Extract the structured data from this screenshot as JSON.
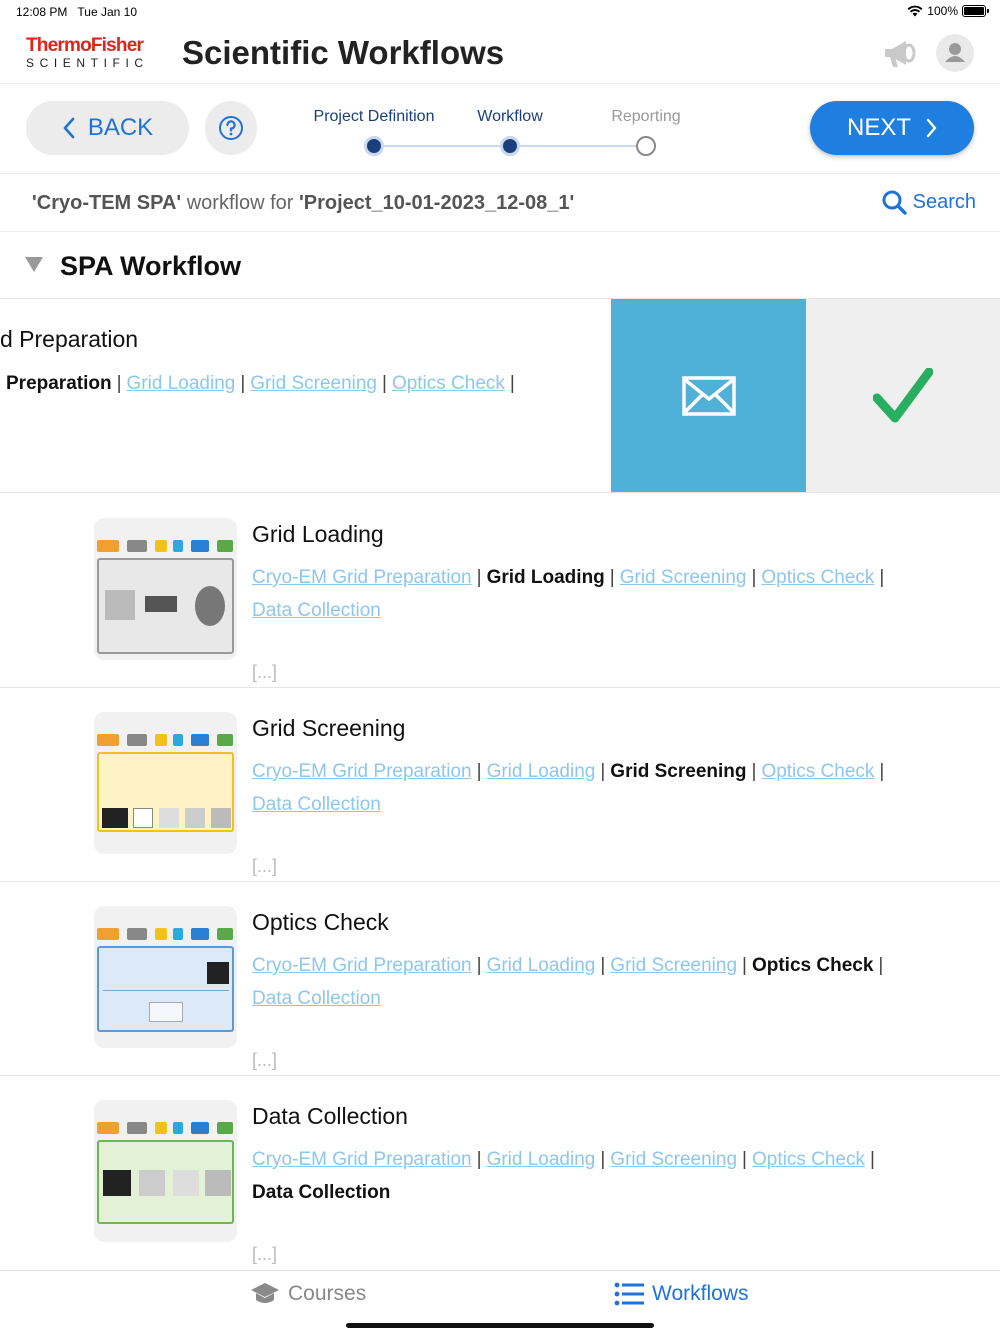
{
  "status": {
    "time": "12:08 PM",
    "date": "Tue Jan 10",
    "battery": "100%"
  },
  "brand": {
    "logo_top": "ThermoFisher",
    "logo_bottom": "SCIENTIFIC",
    "app_title": "Scientific Workflows"
  },
  "nav": {
    "back_label": "BACK",
    "next_label": "NEXT",
    "steps": [
      {
        "label": "Project Definition",
        "state": "done"
      },
      {
        "label": "Workflow",
        "state": "done"
      },
      {
        "label": "Reporting",
        "state": "todo"
      }
    ]
  },
  "context": {
    "workflow_name": "'Cryo-TEM SPA'",
    "middle": " workflow for ",
    "project_name": "'Project_10-01-2023_12-08_1'",
    "search_label": "Search"
  },
  "section": {
    "title": "SPA Workflow"
  },
  "rows": [
    {
      "title": "d Preparation",
      "crumbs": [
        {
          "text": "Preparation",
          "current": true
        },
        {
          "text": "Grid Loading",
          "current": false
        },
        {
          "text": "Grid Screening",
          "current": false
        },
        {
          "text": "Optics Check",
          "current": false
        }
      ]
    },
    {
      "title": "Grid Loading",
      "crumbs": [
        {
          "text": "Cryo-EM Grid Preparation",
          "current": false
        },
        {
          "text": "Grid Loading",
          "current": true
        },
        {
          "text": "Grid Screening",
          "current": false
        },
        {
          "text": "Optics Check",
          "current": false
        },
        {
          "text": "Data Collection",
          "current": false
        }
      ],
      "ellipsis": "[...]"
    },
    {
      "title": "Grid Screening",
      "crumbs": [
        {
          "text": "Cryo-EM Grid Preparation",
          "current": false
        },
        {
          "text": "Grid Loading",
          "current": false
        },
        {
          "text": "Grid Screening",
          "current": true
        },
        {
          "text": "Optics Check",
          "current": false
        },
        {
          "text": "Data Collection",
          "current": false
        }
      ],
      "ellipsis": "[...]"
    },
    {
      "title": "Optics Check",
      "crumbs": [
        {
          "text": "Cryo-EM Grid Preparation",
          "current": false
        },
        {
          "text": "Grid Loading",
          "current": false
        },
        {
          "text": "Grid Screening",
          "current": false
        },
        {
          "text": "Optics Check",
          "current": true
        },
        {
          "text": "Data Collection",
          "current": false
        }
      ],
      "ellipsis": "[...]"
    },
    {
      "title": "Data Collection",
      "crumbs": [
        {
          "text": "Cryo-EM Grid Preparation",
          "current": false
        },
        {
          "text": "Grid Loading",
          "current": false
        },
        {
          "text": "Grid Screening",
          "current": false
        },
        {
          "text": "Optics Check",
          "current": false
        },
        {
          "text": "Data Collection",
          "current": true
        }
      ],
      "ellipsis": "[...]"
    }
  ],
  "tabs": {
    "courses": "Courses",
    "workflows": "Workflows"
  },
  "colors": {
    "accent": "#1f7fe0",
    "brand_red": "#e2231a",
    "link": "#8ec6ec",
    "mail_action": "#4fb0d8",
    "check_green": "#27ae60"
  },
  "icons": [
    "back-chevron-icon",
    "help-icon",
    "next-chevron-icon",
    "search-icon",
    "megaphone-icon",
    "profile-icon",
    "mail-icon",
    "checkmark-icon",
    "graduation-cap-icon",
    "list-icon"
  ]
}
